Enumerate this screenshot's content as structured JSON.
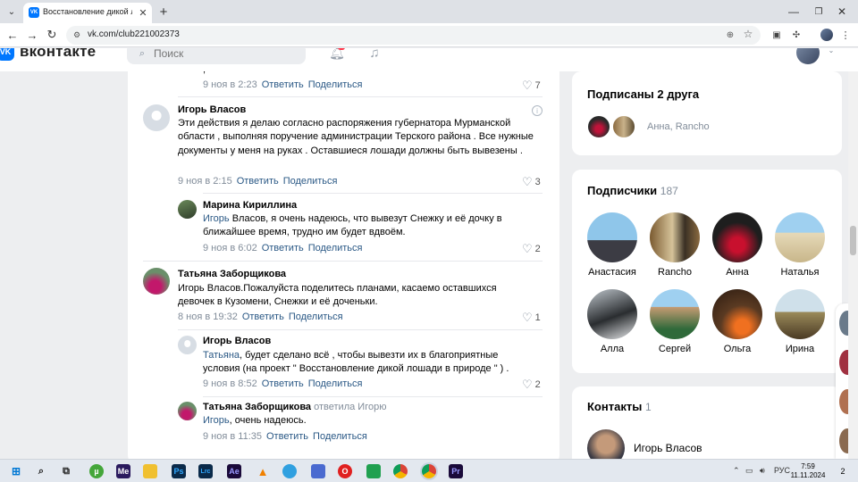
{
  "browser": {
    "tab_title": "Восстановление дикой лошади",
    "url": "vk.com/club221002373",
    "colors": {
      "tabstrip": "#dee1e6",
      "accent": "#0077ff"
    }
  },
  "vk_header": {
    "logo_icon": "VK",
    "logo_text": "вконтакте",
    "search_placeholder": "Поиск"
  },
  "comments": [
    {
      "meta_time": "9 ноя в 2:23",
      "reply_label": "Ответить",
      "share_label": "Поделиться",
      "likes": "7"
    },
    {
      "author": "Игорь Власов",
      "text": "Эти действия я делаю согласно распоряжения губернатора Мурманской области , выполняя поручение администрации Терского района . Все нужные документы у меня на руках . Оставшиеся лошади должны быть вывезены .",
      "meta_time": "9 ноя в 2:15",
      "reply_label": "Ответить",
      "share_label": "Поделиться",
      "likes": "3"
    },
    {
      "author": "Марина Кириллина",
      "mention": "Игорь",
      "text": " Власов, я очень надеюсь, что вывезут Снежку и её дочку в ближайшее время, трудно им будет вдвоём.",
      "meta_time": "9 ноя в 6:02",
      "reply_label": "Ответить",
      "share_label": "Поделиться",
      "likes": "2"
    },
    {
      "author": "Татьяна Заборщикова",
      "text": "Игорь Власов.Пожалуйста поделитесь планами, касаемо оставшихся девочек в Кузомени, Снежки и её доченьки.",
      "meta_time": "8 ноя в 19:32",
      "reply_label": "Ответить",
      "share_label": "Поделиться",
      "likes": "1"
    },
    {
      "author": "Игорь Власов",
      "mention": "Татьяна",
      "text": ", будет сделано всё , чтобы вывезти их в благоприятные условия (на проект \" Восстановление дикой лошади в природе \" ) .",
      "meta_time": "9 ноя в 8:52",
      "reply_label": "Ответить",
      "share_label": "Поделиться",
      "likes": "2"
    },
    {
      "author": "Татьяна Заборщикова",
      "replied_to": "ответила Игорю",
      "mention": "Игорь",
      "text": ", очень надеюсь.",
      "meta_time": "9 ноя в 11:35",
      "reply_label": "Ответить",
      "share_label": "Поделиться"
    }
  ],
  "friends_card": {
    "title": "Подписаны 2 друга",
    "names": "Анна, Rancho"
  },
  "followers_card": {
    "title": "Подписчики",
    "count": "187",
    "items": [
      {
        "name": "Анастасия"
      },
      {
        "name": "Rancho"
      },
      {
        "name": "Анна"
      },
      {
        "name": "Наталья"
      },
      {
        "name": "Алла"
      },
      {
        "name": "Сергей"
      },
      {
        "name": "Ольга"
      },
      {
        "name": "Ирина"
      }
    ]
  },
  "contacts_card": {
    "title": "Контакты",
    "count": "1",
    "contact_name": "Игорь Власов"
  },
  "taskbar": {
    "lang": "РУС",
    "time": "7:59",
    "date": "11.11.2024",
    "notifications": "2",
    "app_labels": {
      "me": "Me",
      "ps": "Ps",
      "lrc": "Lrc",
      "ae": "Ae",
      "pr": "Pr"
    }
  }
}
